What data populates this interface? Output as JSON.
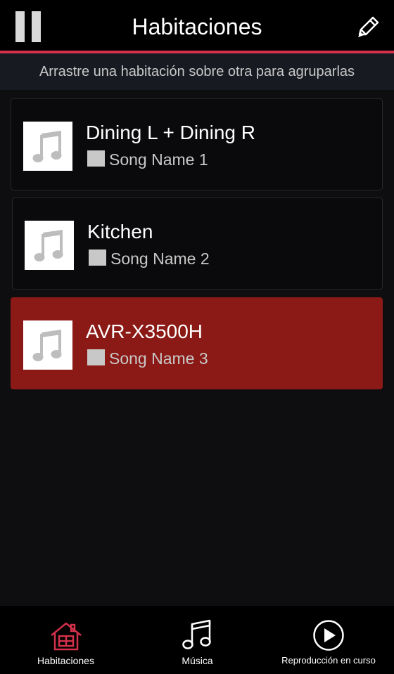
{
  "header": {
    "title": "Habitaciones"
  },
  "hint": "Arrastre una habitación sobre otra para agruparlas",
  "rooms": [
    {
      "name": "Dining L + Dining R",
      "song": "Song Name 1",
      "selected": false
    },
    {
      "name": "Kitchen",
      "song": "Song Name 2",
      "selected": false
    },
    {
      "name": "AVR-X3500H",
      "song": "Song Name 3",
      "selected": true
    }
  ],
  "nav": {
    "items": [
      {
        "label": "Habitaciones",
        "icon": "house-icon",
        "active": true
      },
      {
        "label": "Música",
        "icon": "music-note-icon",
        "active": false
      },
      {
        "label": "Reproducción en curso",
        "icon": "play-circle-icon",
        "active": false
      }
    ]
  },
  "colors": {
    "accent": "#d3304a",
    "selected_card": "#8b1a16",
    "background": "#0e0e11"
  }
}
